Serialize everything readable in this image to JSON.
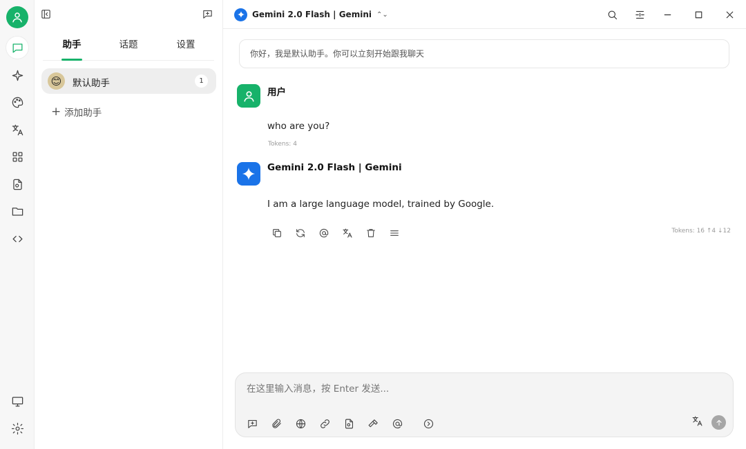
{
  "sidebar_tabs": [
    "助手",
    "话题",
    "设置"
  ],
  "assistant": {
    "name": "默认助手",
    "count": "1",
    "emoji": "😊"
  },
  "add_assistant_label": "添加助手",
  "header": {
    "model_label": "Gemini 2.0 Flash | Gemini"
  },
  "notice": "你好，我是默认助手。你可以立刻开始跟我聊天",
  "messages": [
    {
      "author": "用户",
      "text": "who are you?",
      "tokens": "Tokens: 4"
    },
    {
      "author": "Gemini 2.0 Flash | Gemini",
      "text": "I am a large language model, trained by Google.",
      "tokens": "Tokens: 16 ↑4 ↓12"
    }
  ],
  "composer": {
    "placeholder": "在这里输入消息，按 Enter 发送..."
  },
  "colors": {
    "accent": "#17b26a",
    "gemini": "#1a73e8"
  }
}
